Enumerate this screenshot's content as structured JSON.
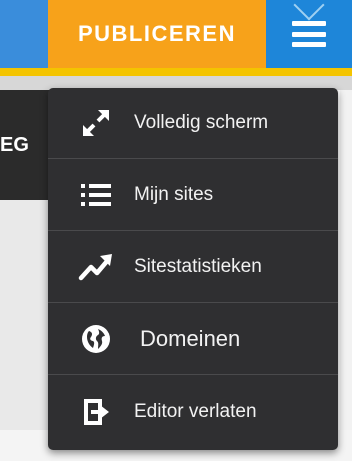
{
  "toolbar": {
    "publish_label": "PUBLICEREN",
    "menu_icon": "hamburger-icon"
  },
  "background": {
    "partial_text": "EG"
  },
  "menu": {
    "items": [
      {
        "label": "Volledig scherm",
        "icon": "fullscreen-icon"
      },
      {
        "label": "Mijn sites",
        "icon": "list-icon"
      },
      {
        "label": "Sitestatistieken",
        "icon": "trend-chart-icon"
      },
      {
        "label": "Domeinen",
        "icon": "globe-icon"
      },
      {
        "label": "Editor verlaten",
        "icon": "exit-icon"
      }
    ]
  },
  "colors": {
    "publish": "#f7a21a",
    "menu_button": "#1e86d9",
    "dropdown": "#2f2f31",
    "accent_strip": "#f4c400"
  }
}
